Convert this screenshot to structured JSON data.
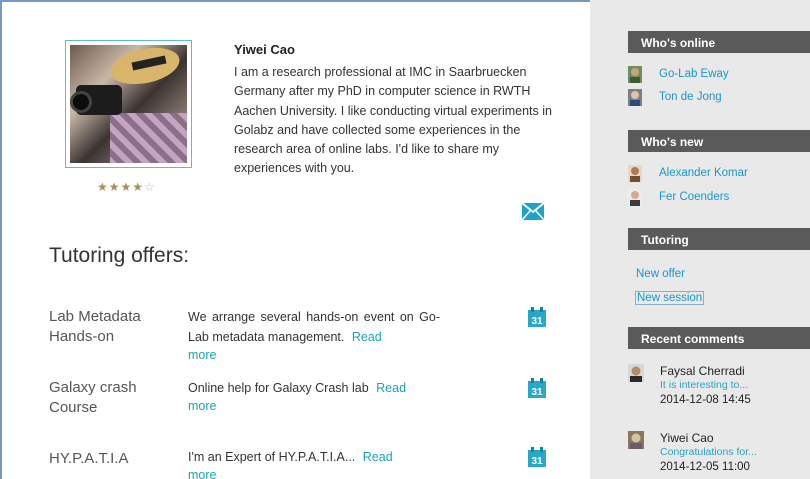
{
  "profile": {
    "name": "Yiwei Cao",
    "bio": "I am a research professional at IMC in Saarbruecken Germany after my PhD in computer science in RWTH Aachen University. I like conducting virtual experiments in Golabz and have collected some experiences in the research area of online labs. I'd like to share my experiences with you.",
    "rating": "4 of 5 stars",
    "rating_value": 4,
    "stars_filled": "★★★★",
    "stars_empty": "☆"
  },
  "tutoring": {
    "title": "Tutoring offers:",
    "offers": [
      {
        "title": "Lab Metadata Hands-on",
        "desc": "We arrange several hands-on event on Go-Lab metadata management.",
        "read": "Read",
        "more": "more",
        "cal": "31"
      },
      {
        "title": "Galaxy crash Course",
        "desc": "Online help for Galaxy Crash lab",
        "read": "Read",
        "more": "more",
        "cal": "31"
      },
      {
        "title": "HY.P.A.T.I.A",
        "desc": "I'm an Expert of HY.P.A.T.I.A...",
        "read": "Read",
        "more": "more",
        "cal": "31"
      }
    ]
  },
  "sidebar": {
    "online": {
      "title": "Who's online",
      "users": [
        "Go-Lab Eway",
        "Ton de Jong"
      ]
    },
    "new": {
      "title": "Who's new",
      "users": [
        "Alexander Komar",
        "Fer Coenders"
      ]
    },
    "tutoring": {
      "title": "Tutoring",
      "links": [
        "New offer",
        "New session"
      ]
    },
    "comments": {
      "title": "Recent comments",
      "items": [
        {
          "who": "Faysal Cherradi",
          "snip": "It is interesting to...",
          "time": "2014-12-08 14:45"
        },
        {
          "who": "Yiwei Cao",
          "snip": "Congratulations for...",
          "time": "2014-12-05 11:00"
        }
      ]
    }
  },
  "colors": {
    "accent": "#1aa4b0",
    "link": "#1a96c9",
    "header": "#5a5a5a",
    "sidebar_bg": "#e9e9e9"
  }
}
